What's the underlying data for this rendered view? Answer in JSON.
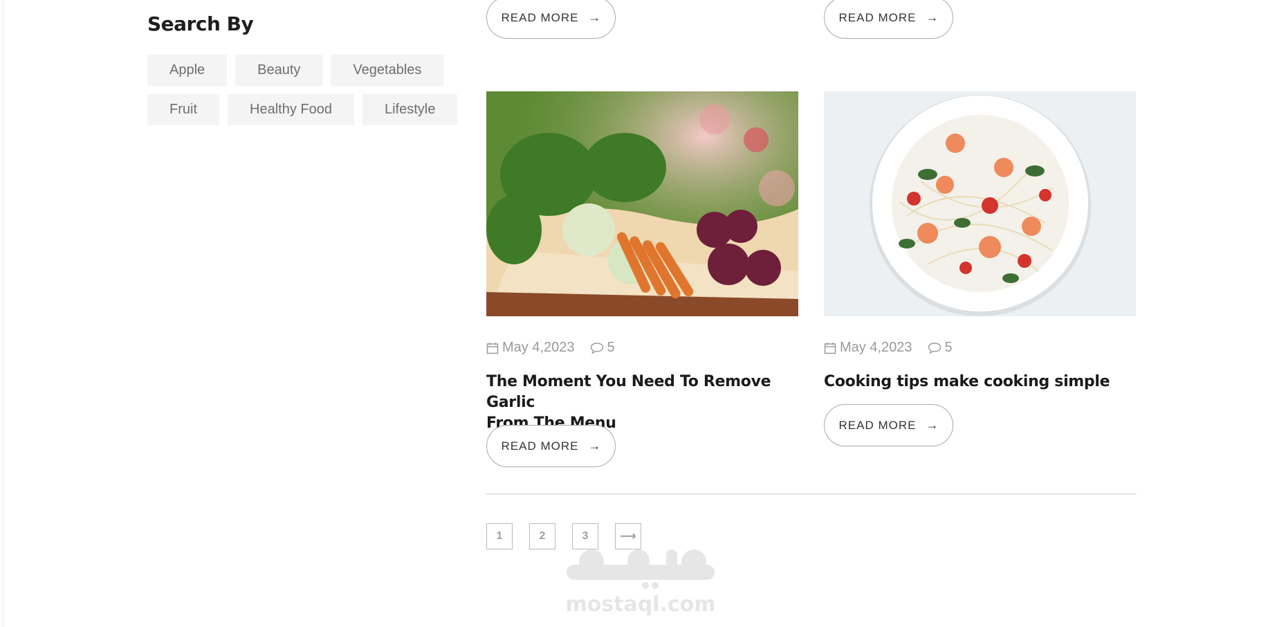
{
  "sidebar": {
    "title": "Search By",
    "tags": [
      "Apple",
      "Beauty",
      "Vegetables",
      "Fruit",
      "Healthy Food",
      "Lifestyle"
    ]
  },
  "read_more_label": "READ MORE",
  "read_more_arrow": "→",
  "posts": [
    {
      "image": "vegetables-basket-image",
      "date": "May 4,2023",
      "comments": "5",
      "title_line1": "The Moment You Need To Remove Garlic",
      "title_line2": "From The Menu"
    },
    {
      "image": "shrimp-pasta-image",
      "date": "May 4,2023",
      "comments": "5",
      "title_line1": "Cooking tips make cooking simple",
      "title_line2": ""
    }
  ],
  "pagination": {
    "pages": [
      "1",
      "2",
      "3"
    ],
    "next": "⟶"
  },
  "watermark": {
    "text": "mostaql.com"
  }
}
